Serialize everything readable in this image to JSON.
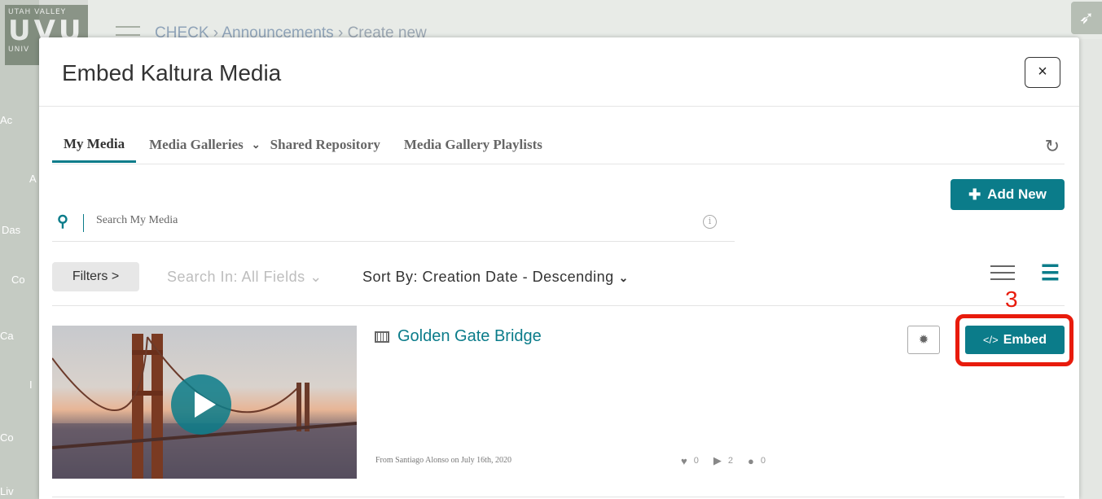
{
  "background": {
    "logo_top": "UTAH VALLEY",
    "logo_big": "UVU",
    "logo_bottom": "UNIV",
    "breadcrumb": {
      "root": "CHECK",
      "section": "Announcements",
      "current": "Create new"
    },
    "side_labels": [
      "Ac",
      "A",
      "Das",
      "Co",
      "Ca",
      "I",
      "Co",
      "Liv"
    ]
  },
  "modal": {
    "title": "Embed Kaltura Media",
    "close_label": "×"
  },
  "tabs": [
    {
      "label": "My Media",
      "active": true
    },
    {
      "label": "Media Galleries",
      "dropdown": true
    },
    {
      "label": "Shared Repository"
    },
    {
      "label": "Media Gallery Playlists"
    }
  ],
  "toolbar": {
    "add_new_label": "Add New",
    "search_placeholder": "Search My Media",
    "filters_label": "Filters >",
    "search_in_label": "Search In: All Fields",
    "sort_by_label": "Sort By: Creation Date - Descending"
  },
  "entry": {
    "title": "Golden Gate Bridge",
    "meta": "From Santiago Alonso on July 16th, 2020",
    "likes": "0",
    "plays": "2",
    "comments": "0",
    "embed_label": "Embed",
    "embed_code_glyph": "</>"
  },
  "annotation": {
    "step_number": "3",
    "color": "#e81b0c"
  },
  "colors": {
    "accent": "#0b7c8a"
  }
}
